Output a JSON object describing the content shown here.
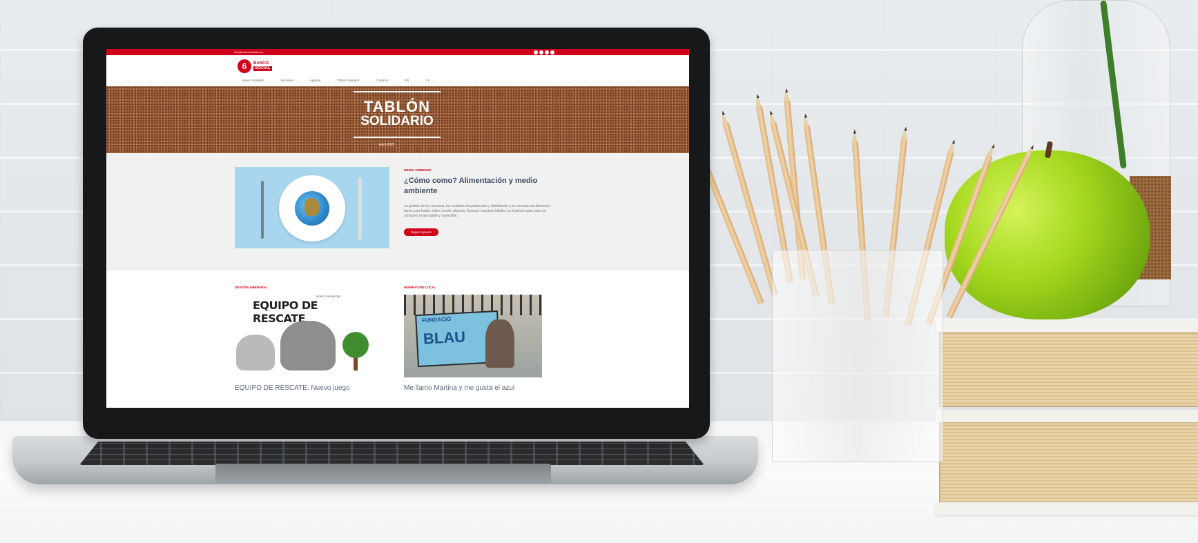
{
  "site": {
    "topbar_contact": "info@bancosolidario.es",
    "logo_top": "BANCO",
    "logo_bottom": "SOCIAL",
    "nav": [
      "Banco Solidario",
      "Servicios",
      "Agenda",
      "Tablón Solidario",
      "Contacto",
      "ES",
      "CA"
    ]
  },
  "hero": {
    "title_line1": "TABLÓN",
    "title_line2": "SOLIDARIO",
    "subtitle": "Abril 2021"
  },
  "feature": {
    "category": "Medio ambiente",
    "title": "¿Cómo como? Alimentación y medio ambiente",
    "body": "La gestión de los recursos, los modelos de producción y distribución y el consumo de alimentos tienen una huella sobre nuestro planeta. Conocer nuestros hábitos es el primer paso para un consumo responsable y sostenible.",
    "button": "Seguir leyendo"
  },
  "articles": [
    {
      "category": "Gestión ambiental",
      "image_title": "EQUIPO DE RESCATE",
      "image_tag": "ROBOT MONSTER",
      "title": "EQUIPO DE RESCATE. Nuevo juego"
    },
    {
      "category": "Inspiración local",
      "image_title": "BLAU",
      "image_sub": "FUNDACIÓ",
      "title": "Me llamo Martina y me gusta el azul"
    }
  ],
  "colors": {
    "brand_red": "#d0021b",
    "cork": "#9c5e3b",
    "feature_bg": "#f1f1f2",
    "heading": "#394a5e"
  },
  "icons": [
    "social-icon",
    "logo-mark-icon"
  ]
}
